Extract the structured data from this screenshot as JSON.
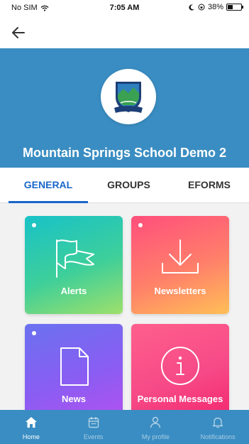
{
  "status_bar": {
    "carrier": "No SIM",
    "time": "7:05 AM",
    "battery": "38%",
    "battery_level": 0.38
  },
  "header": {
    "school_name": "Mountain Springs School Demo 2"
  },
  "tabs": [
    {
      "label": "GENERAL",
      "active": true
    },
    {
      "label": "GROUPS",
      "active": false
    },
    {
      "label": "EFORMS",
      "active": false
    }
  ],
  "tiles": [
    {
      "label": "Alerts",
      "icon": "flag-icon",
      "unread": true
    },
    {
      "label": "Newsletters",
      "icon": "download-icon",
      "unread": true
    },
    {
      "label": "News",
      "icon": "document-icon",
      "unread": true
    },
    {
      "label": "Personal Messages",
      "icon": "info-icon",
      "unread": false
    }
  ],
  "bottom_nav": [
    {
      "label": "Home",
      "icon": "home-icon",
      "active": true
    },
    {
      "label": "Events",
      "icon": "calendar-icon",
      "active": false
    },
    {
      "label": "My profile",
      "icon": "person-icon",
      "active": false
    },
    {
      "label": "Notifications",
      "icon": "bell-icon",
      "active": false
    }
  ],
  "colors": {
    "header": "#3a8dc2",
    "active_tab": "#1a66c9"
  }
}
